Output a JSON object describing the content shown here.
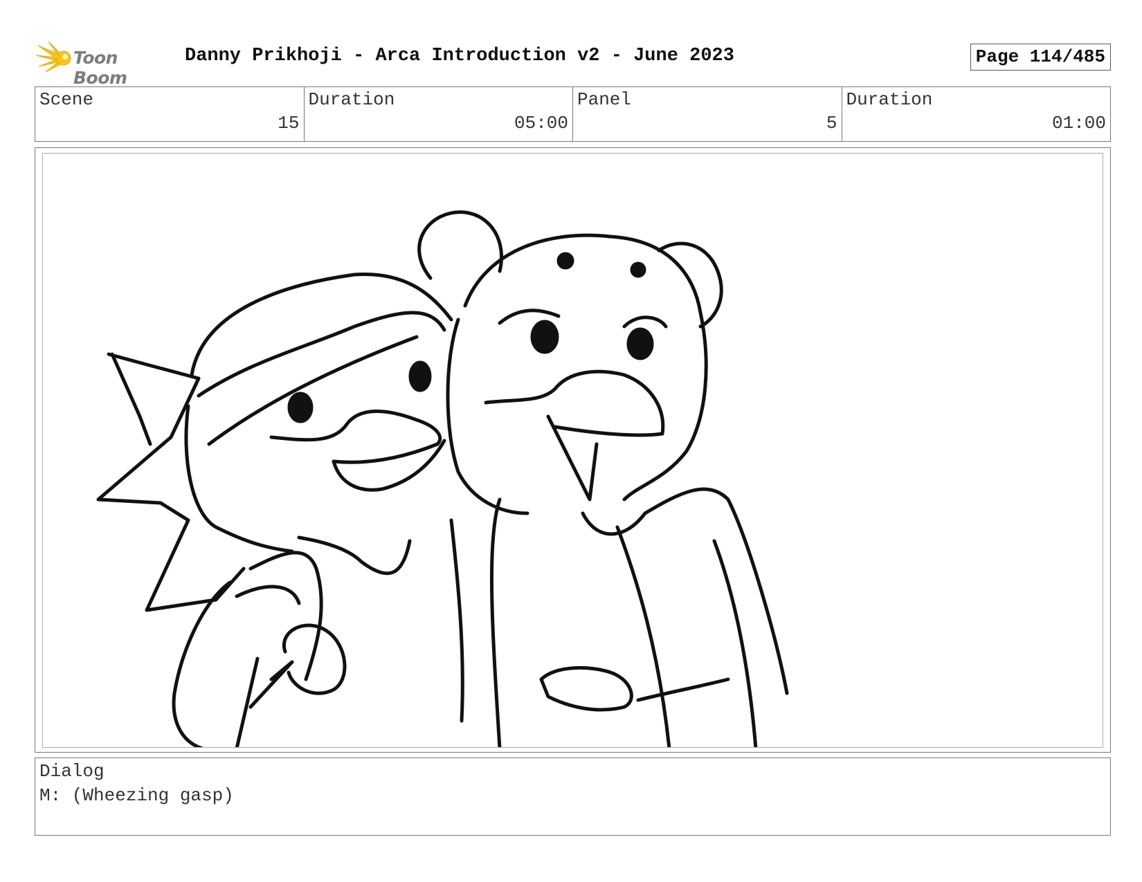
{
  "header": {
    "logo_text": "Toon Boom",
    "title": "Danny Prikhoji - Arca Introduction v2 - June 2023",
    "page": "Page 114/485"
  },
  "info": {
    "scene_label": "Scene",
    "scene_value": "15",
    "duration_label": "Duration",
    "duration_value": "05:00",
    "panel_label": "Panel",
    "panel_value": "5",
    "panel_duration_label": "Duration",
    "panel_duration_value": "01:00"
  },
  "dialog": {
    "label": "Dialog",
    "text": "M: (Wheezing gasp)"
  },
  "colors": {
    "logo_accent": "#f5c518",
    "border": "#777777"
  }
}
